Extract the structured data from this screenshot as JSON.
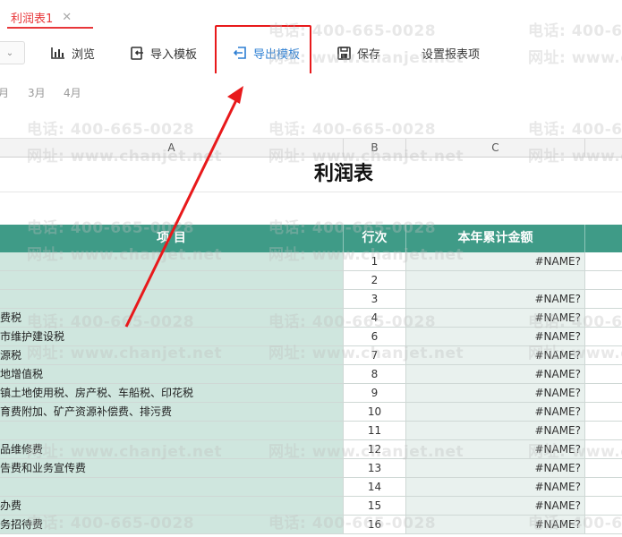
{
  "tab": {
    "label": "利润表1",
    "close": "✕"
  },
  "toolbar": {
    "dropdown": "⌄",
    "buttons": [
      {
        "label": "浏览",
        "icon": "chart-icon"
      },
      {
        "label": "导入模板",
        "icon": "import-icon"
      },
      {
        "label": "导出模板",
        "icon": "export-icon",
        "active": true
      },
      {
        "label": "保存",
        "icon": "save-icon"
      },
      {
        "label": "设置报表项",
        "icon": ""
      }
    ]
  },
  "months": [
    "月",
    "3月",
    "4月"
  ],
  "columns": {
    "a": "A",
    "b": "B",
    "c": "C"
  },
  "sheet": {
    "title": "利润表",
    "headers": {
      "item": "项  目",
      "line": "行次",
      "amount": "本年累计金额"
    },
    "rows": [
      {
        "item": "",
        "line": "1",
        "amount": "#NAME?"
      },
      {
        "item": "",
        "line": "2",
        "amount": ""
      },
      {
        "item": "",
        "line": "3",
        "amount": "#NAME?"
      },
      {
        "item": "费税",
        "line": "4",
        "amount": "#NAME?"
      },
      {
        "item": "市维护建设税",
        "line": "6",
        "amount": "#NAME?"
      },
      {
        "item": "源税",
        "line": "7",
        "amount": "#NAME?"
      },
      {
        "item": "地增值税",
        "line": "8",
        "amount": "#NAME?"
      },
      {
        "item": "镇土地使用税、房产税、车船税、印花税",
        "line": "9",
        "amount": "#NAME?"
      },
      {
        "item": "育费附加、矿产资源补偿费、排污费",
        "line": "10",
        "amount": "#NAME?"
      },
      {
        "item": "",
        "line": "11",
        "amount": "#NAME?"
      },
      {
        "item": "品维修费",
        "line": "12",
        "amount": "#NAME?"
      },
      {
        "item": "告费和业务宣传费",
        "line": "13",
        "amount": "#NAME?"
      },
      {
        "item": "",
        "line": "14",
        "amount": "#NAME?"
      },
      {
        "item": "办费",
        "line": "15",
        "amount": "#NAME?"
      },
      {
        "item": "务招待费",
        "line": "16",
        "amount": "#NAME?"
      }
    ]
  },
  "watermark": {
    "phone": "电话: 400-665-0028",
    "site": "网址: www.chanjet.net"
  },
  "colors": {
    "accent": "#e8373a",
    "header_bg": "#3f9b87",
    "col_a_bg": "#cfe6de",
    "col_c_bg": "#e9f1ee",
    "active_blue": "#2d7fd3",
    "annotation_red": "#e8191b"
  }
}
